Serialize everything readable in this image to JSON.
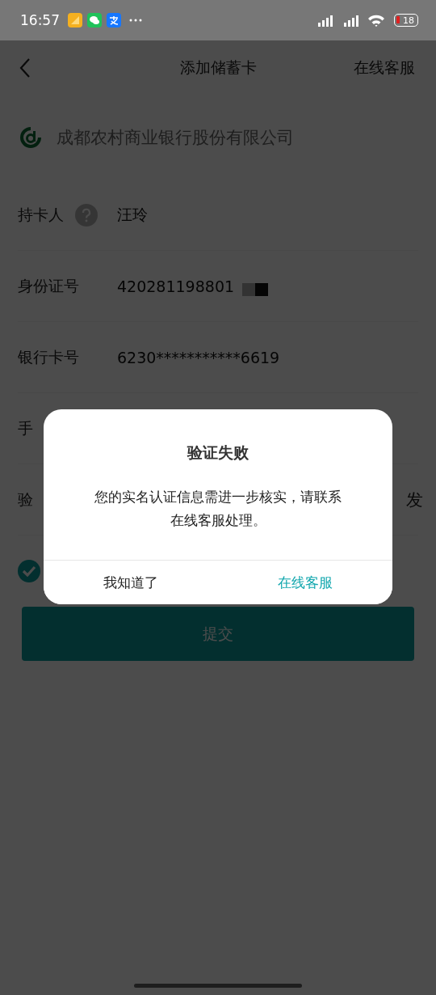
{
  "status_bar": {
    "time": "16:57",
    "battery": "18"
  },
  "header": {
    "title": "添加储蓄卡",
    "action": "在线客服"
  },
  "bank": {
    "name": "成都农村商业银行股份有限公司"
  },
  "fields": [
    {
      "label": "持卡人",
      "value": "汪玲",
      "kind": "help"
    },
    {
      "label": "身份证号",
      "value": "420281198801",
      "kind": "redacted"
    },
    {
      "label": "银行卡号",
      "value": "6230***********6619",
      "kind": "plain"
    },
    {
      "label": "手",
      "kind": "plain"
    },
    {
      "label": "验",
      "action": "发",
      "kind": "plain"
    }
  ],
  "agreement": {
    "checked": true
  },
  "submit": {
    "label": "提交"
  },
  "dialog": {
    "title": "验证失败",
    "message": "您的实名认证信息需进一步核实，请联系在线客服处理。",
    "buttons": [
      {
        "label": "我知道了",
        "kind": "secondary"
      },
      {
        "label": "在线客服",
        "kind": "primary"
      }
    ]
  }
}
